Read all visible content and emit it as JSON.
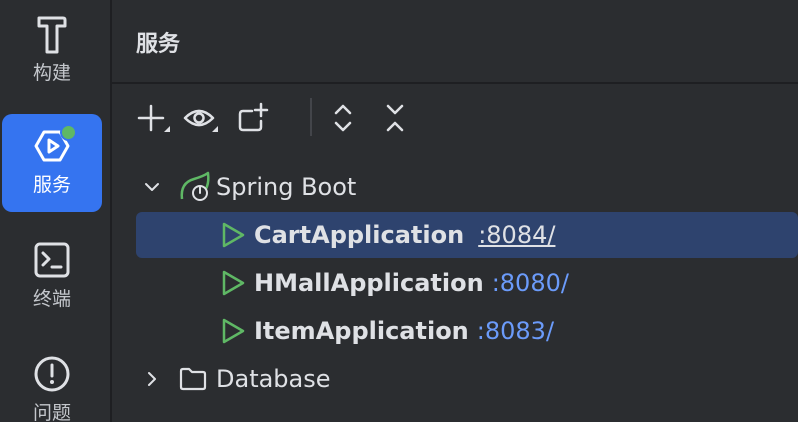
{
  "toolstrip": {
    "items": [
      {
        "label": "构建",
        "icon": "hammer-icon"
      },
      {
        "label": "服务",
        "icon": "services-icon",
        "active": true
      },
      {
        "label": "终端",
        "icon": "terminal-icon"
      },
      {
        "label": "问题",
        "icon": "problems-icon"
      }
    ]
  },
  "panel": {
    "title": "服务",
    "toolbar": [
      "add-icon",
      "eye-icon",
      "new-group-icon",
      "expand-all-icon",
      "collapse-all-icon"
    ]
  },
  "tree": {
    "spring_boot": {
      "label": "Spring Boot",
      "expanded": true
    },
    "apps": [
      {
        "name": "CartApplication",
        "port": ":8084/",
        "selected": true
      },
      {
        "name": "HMallApplication",
        "port": ":8080/"
      },
      {
        "name": "ItemApplication",
        "port": ":8083/"
      }
    ],
    "database": {
      "label": "Database",
      "expanded": false
    }
  },
  "colors": {
    "background": "#2b2d30",
    "accent": "#3574f0",
    "selection": "#2e436e",
    "run_green": "#5fb865",
    "link_blue": "#6b9bfa"
  }
}
